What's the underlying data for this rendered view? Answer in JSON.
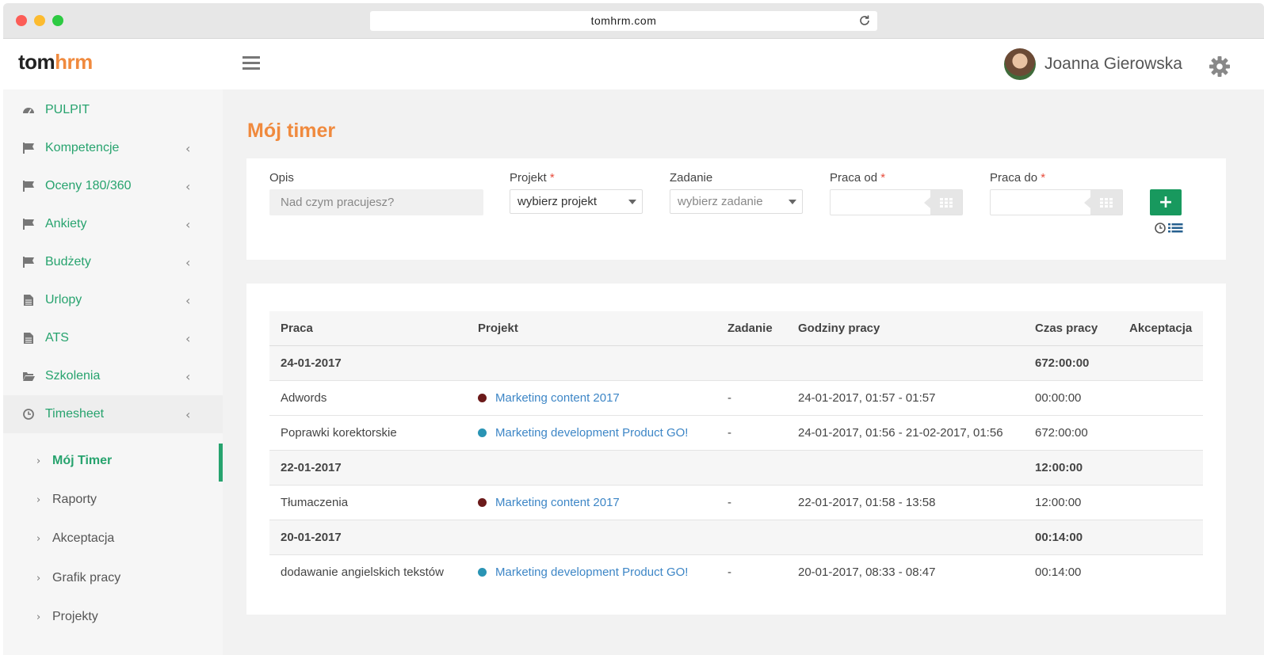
{
  "browser": {
    "url": "tomhrm.com"
  },
  "header": {
    "logo_part1": "tom",
    "logo_part2": "hrm",
    "user_name": "Joanna Gierowska"
  },
  "sidebar": {
    "items": [
      {
        "label": "PULPIT",
        "icon": "dashboard-icon"
      },
      {
        "label": "Kompetencje",
        "icon": "flag-icon"
      },
      {
        "label": "Oceny 180/360",
        "icon": "flag-icon"
      },
      {
        "label": "Ankiety",
        "icon": "flag-icon"
      },
      {
        "label": "Budżety",
        "icon": "flag-icon"
      },
      {
        "label": "Urlopy",
        "icon": "document-icon"
      },
      {
        "label": "ATS",
        "icon": "document-icon"
      },
      {
        "label": "Szkolenia",
        "icon": "folder-open-icon"
      },
      {
        "label": "Timesheet",
        "icon": "clock-icon"
      }
    ],
    "subitems": [
      {
        "label": "Mój Timer",
        "active": true
      },
      {
        "label": "Raporty"
      },
      {
        "label": "Akceptacja"
      },
      {
        "label": "Grafik pracy"
      },
      {
        "label": "Projekty"
      }
    ]
  },
  "page": {
    "title": "Mój timer"
  },
  "form": {
    "opis_label": "Opis",
    "opis_placeholder": "Nad czym pracujesz?",
    "projekt_label": "Projekt",
    "projekt_value": "wybierz projekt",
    "zadanie_label": "Zadanie",
    "zadanie_value": "wybierz zadanie",
    "praca_od_label": "Praca od",
    "praca_do_label": "Praca do",
    "required_mark": "*",
    "add_label": "+"
  },
  "table": {
    "columns": [
      "Praca",
      "Projekt",
      "Zadanie",
      "Godziny pracy",
      "Czas pracy",
      "Akceptacja"
    ],
    "rows": [
      {
        "type": "group",
        "date": "24-01-2017",
        "total": "672:00:00"
      },
      {
        "type": "entry",
        "work": "Adwords",
        "project": "Marketing content 2017",
        "project_color": "#6b1a1a",
        "task": "-",
        "hours": "24-01-2017, 01:57 - 01:57",
        "time": "00:00:00"
      },
      {
        "type": "entry",
        "work": "Poprawki korektorskie",
        "project": "Marketing development Product GO!",
        "project_color": "#2a94b4",
        "task": "-",
        "hours": "24-01-2017, 01:56 - 21-02-2017, 01:56",
        "time": "672:00:00"
      },
      {
        "type": "group",
        "date": "22-01-2017",
        "total": "12:00:00"
      },
      {
        "type": "entry",
        "work": "Tłumaczenia",
        "project": "Marketing content 2017",
        "project_color": "#6b1a1a",
        "task": "-",
        "hours": "22-01-2017, 01:58 - 13:58",
        "time": "12:00:00"
      },
      {
        "type": "group",
        "date": "20-01-2017",
        "total": "00:14:00"
      },
      {
        "type": "entry",
        "work": "dodawanie angielskich tekstów",
        "project": "Marketing development Product GO!",
        "project_color": "#2a94b4",
        "task": "-",
        "hours": "20-01-2017, 08:33 - 08:47",
        "time": "00:14:00"
      }
    ]
  },
  "colors": {
    "accent": "#27a36e",
    "title": "#f08a3e",
    "link": "#3d86c6",
    "add_button": "#18995e"
  }
}
